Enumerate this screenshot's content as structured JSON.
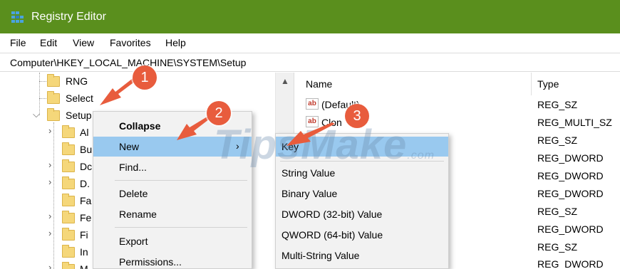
{
  "window": {
    "title": "Registry Editor",
    "titlebar_color": "#5a8f1d",
    "app_icon": "registry-icon"
  },
  "menu": [
    "File",
    "Edit",
    "View",
    "Favorites",
    "Help"
  ],
  "address": "Computer\\HKEY_LOCAL_MACHINE\\SYSTEM\\Setup",
  "tree": {
    "rng": "RNG",
    "select": "Select",
    "setup": "Setup",
    "children": [
      "Al",
      "Bu",
      "Dc",
      "D.",
      "Fa",
      "Fe",
      "Fi",
      "In",
      "M"
    ]
  },
  "values_pane": {
    "headers": {
      "name": "Name",
      "type": "Type"
    },
    "names": [
      "(Default)",
      "Clon"
    ],
    "types": [
      "REG_SZ",
      "REG_MULTI_SZ",
      "REG_SZ",
      "REG_DWORD",
      "REG_DWORD",
      "REG_DWORD",
      "REG_SZ",
      "REG_DWORD",
      "REG_SZ",
      "REG_DWORD"
    ]
  },
  "context_menu": {
    "collapse": "Collapse",
    "new": "New",
    "find": "Find...",
    "delete": "Delete",
    "rename": "Rename",
    "export": "Export",
    "permissions": "Permissions..."
  },
  "new_submenu": [
    "Key",
    "String Value",
    "Binary Value",
    "DWORD (32-bit) Value",
    "QWORD (64-bit) Value",
    "Multi-String Value"
  ],
  "annotations": {
    "badges": [
      "1",
      "2",
      "3"
    ],
    "color": "#e85c3d"
  },
  "watermark": {
    "text": "TipsMake",
    "suffix": ".com"
  }
}
